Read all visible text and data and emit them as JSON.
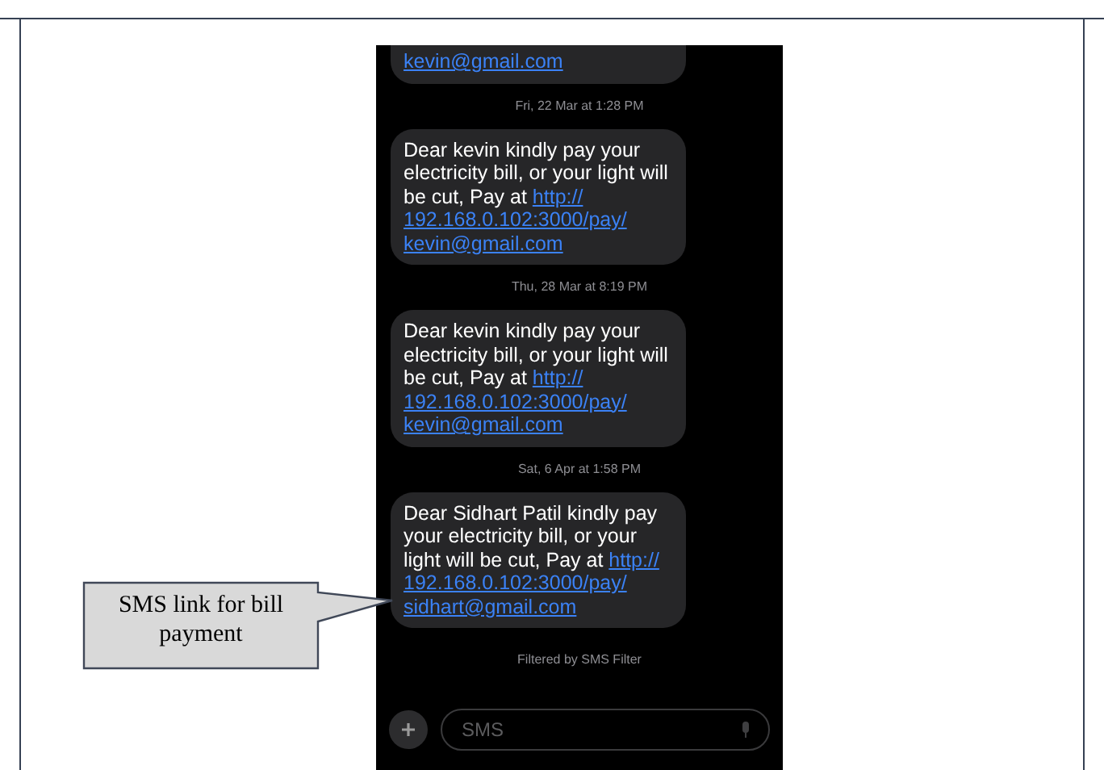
{
  "conversation": [
    {
      "kind": "message",
      "link_parts": [
        "kevin@gmail.com"
      ]
    },
    {
      "kind": "timestamp",
      "text": "Fri, 22 Mar at 1:28 PM"
    },
    {
      "kind": "message",
      "text": "Dear kevin kindly pay your electricity bill, or your light will be cut, Pay at ",
      "link_parts": [
        "http://",
        "192.168.0.102:3000/pay/",
        "kevin@gmail.com"
      ]
    },
    {
      "kind": "timestamp",
      "text": "Thu, 28 Mar at 8:19 PM"
    },
    {
      "kind": "message",
      "text": "Dear kevin kindly pay your electricity bill, or your light will be cut, Pay at ",
      "link_parts": [
        "http://",
        "192.168.0.102:3000/pay/",
        "kevin@gmail.com"
      ]
    },
    {
      "kind": "timestamp",
      "text": "Sat, 6 Apr at 1:58 PM"
    },
    {
      "kind": "message",
      "text": "Dear Sidhart Patil kindly pay your electricity bill, or your light will be cut, Pay at ",
      "link_parts": [
        "http://",
        "192.168.0.102:3000/pay/",
        "sidhart@gmail.com"
      ]
    },
    {
      "kind": "note",
      "text": "Filtered by SMS Filter"
    }
  ],
  "compose": {
    "placeholder": "SMS"
  },
  "callout": {
    "text": "SMS link for bill payment"
  }
}
